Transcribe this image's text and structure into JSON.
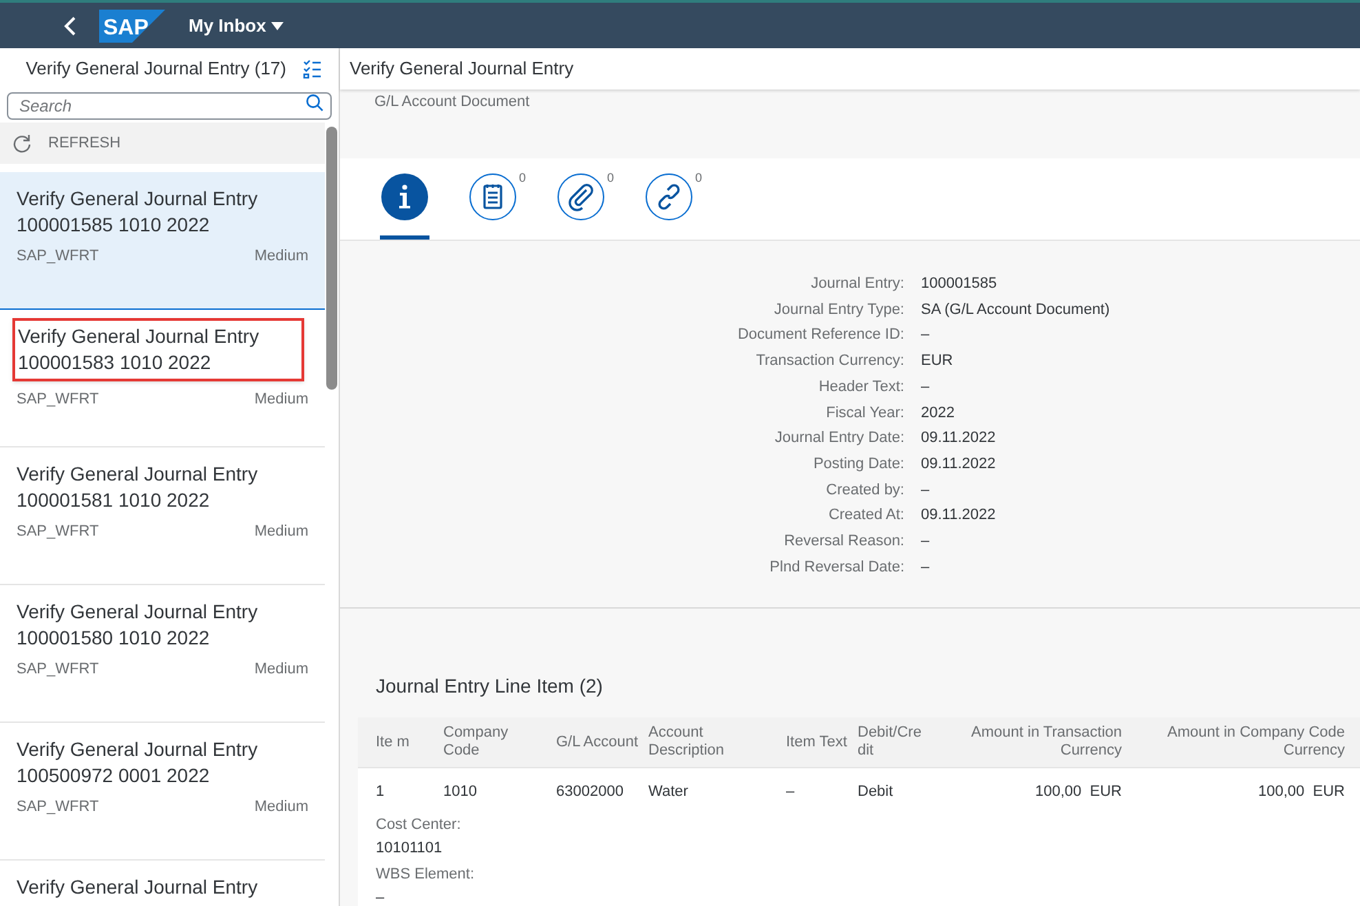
{
  "shell": {
    "logo_text": "SAP",
    "app_title": "My Inbox"
  },
  "master": {
    "title": "Verify General Journal Entry (17)",
    "search": {
      "placeholder": "Search"
    },
    "refresh_label": "REFRESH",
    "items": [
      {
        "title": "Verify General Journal Entry 100001585 1010 2022",
        "user": "SAP_WFRT",
        "priority": "Medium",
        "selected": true,
        "highlighted": false
      },
      {
        "title": "Verify General Journal Entry 100001583 1010 2022",
        "user": "SAP_WFRT",
        "priority": "Medium",
        "selected": false,
        "highlighted": true
      },
      {
        "title": "Verify General Journal Entry 100001581 1010 2022",
        "user": "SAP_WFRT",
        "priority": "Medium",
        "selected": false,
        "highlighted": false
      },
      {
        "title": "Verify General Journal Entry 100001580 1010 2022",
        "user": "SAP_WFRT",
        "priority": "Medium",
        "selected": false,
        "highlighted": false
      },
      {
        "title": "Verify General Journal Entry 100500972 0001 2022",
        "user": "SAP_WFRT",
        "priority": "Medium",
        "selected": false,
        "highlighted": false
      },
      {
        "title": "Verify General Journal Entry",
        "selected": false,
        "highlighted": false
      }
    ]
  },
  "detail": {
    "title": "Verify General Journal Entry",
    "subtitle": "G/L Account Document",
    "tabs": [
      {
        "kind": "info",
        "selected": true
      },
      {
        "kind": "notes",
        "count": "0",
        "selected": false
      },
      {
        "kind": "attachments",
        "count": "0",
        "selected": false
      },
      {
        "kind": "links",
        "count": "0",
        "selected": false
      }
    ],
    "fields": [
      {
        "label": "Journal Entry:",
        "value": "100001585"
      },
      {
        "label": "Journal Entry Type:",
        "value": "SA (G/L Account Document)"
      },
      {
        "label": "Document Reference ID:",
        "value": "–"
      },
      {
        "label": "Transaction Currency:",
        "value": "EUR"
      },
      {
        "label": "Header Text:",
        "value": "–"
      },
      {
        "label": "Fiscal Year:",
        "value": "2022"
      },
      {
        "label": "Journal Entry Date:",
        "value": "09.11.2022"
      },
      {
        "label": "Posting Date:",
        "value": "09.11.2022"
      },
      {
        "label": "Created by:",
        "value": "–"
      },
      {
        "label": "Created At:",
        "value": "09.11.2022"
      },
      {
        "label": "Reversal Reason:",
        "value": "–"
      },
      {
        "label": "Plnd Reversal Date:",
        "value": "–"
      }
    ],
    "table": {
      "title": "Journal Entry Line Item (2)",
      "columns": [
        {
          "label": "Ite m",
          "kind": "text"
        },
        {
          "label": "Company Code",
          "kind": "text"
        },
        {
          "label": "G/L Account",
          "kind": "text"
        },
        {
          "label": "Account Description",
          "kind": "text"
        },
        {
          "label": "Item Text",
          "kind": "text"
        },
        {
          "label": "Debit/Cre dit",
          "kind": "text"
        },
        {
          "label": "Amount in Transaction Currency",
          "kind": "amount"
        },
        {
          "label": "Amount in Company Code Currency",
          "kind": "amount"
        }
      ],
      "rows": [
        {
          "cells": [
            "1",
            "1010",
            "63002000",
            "Water",
            "–",
            "Debit",
            "100,00  EUR",
            "100,00  EUR"
          ],
          "extra": [
            {
              "label": "Cost Center:",
              "value": "10101101"
            },
            {
              "label": "WBS Element:",
              "value": "–"
            }
          ]
        }
      ]
    }
  }
}
